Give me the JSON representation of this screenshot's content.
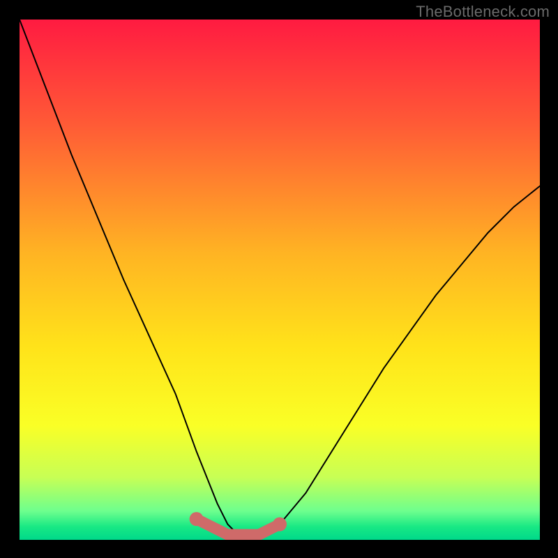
{
  "watermark": "TheBottleneck.com",
  "chart_data": {
    "type": "line",
    "title": "",
    "xlabel": "",
    "ylabel": "",
    "xlim": [
      0,
      100
    ],
    "ylim": [
      0,
      100
    ],
    "series": [
      {
        "name": "bottleneck-curve",
        "x": [
          0,
          5,
          10,
          15,
          20,
          25,
          30,
          34,
          36,
          38,
          40,
          42,
          44,
          46,
          48,
          50,
          55,
          60,
          65,
          70,
          75,
          80,
          85,
          90,
          95,
          100
        ],
        "values": [
          100,
          87,
          74,
          62,
          50,
          39,
          28,
          17,
          12,
          7,
          3,
          1,
          0,
          0,
          1,
          3,
          9,
          17,
          25,
          33,
          40,
          47,
          53,
          59,
          64,
          68
        ]
      },
      {
        "name": "optimal-band",
        "x": [
          34,
          36,
          38,
          40,
          42,
          44,
          46,
          48,
          50
        ],
        "values": [
          4,
          3,
          2,
          1,
          1,
          1,
          1,
          2,
          3
        ]
      }
    ],
    "optimal_marker_color": "#cf6a69",
    "curve_color": "#000000",
    "gradient_stops": [
      {
        "offset": 0.0,
        "color": "#ff1b41"
      },
      {
        "offset": 0.2,
        "color": "#ff5a36"
      },
      {
        "offset": 0.45,
        "color": "#ffb423"
      },
      {
        "offset": 0.63,
        "color": "#ffe31a"
      },
      {
        "offset": 0.78,
        "color": "#faff26"
      },
      {
        "offset": 0.88,
        "color": "#c7ff55"
      },
      {
        "offset": 0.945,
        "color": "#6dff8e"
      },
      {
        "offset": 0.975,
        "color": "#18e884"
      },
      {
        "offset": 1.0,
        "color": "#00d98a"
      }
    ]
  }
}
